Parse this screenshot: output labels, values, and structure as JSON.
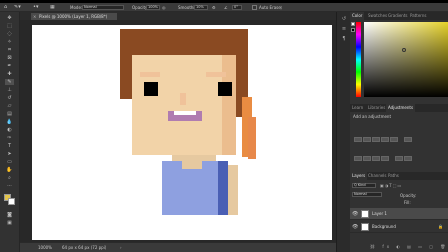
{
  "options_bar": {
    "mode_label": "Mode:",
    "mode_value": "Normal",
    "opacity_label": "Opacity:",
    "opacity_value": "100%",
    "smoothing_label": "Smoothing:",
    "smoothing_value": "10%",
    "angle_value": "0°",
    "auto_erase_label": "Auto Erase"
  },
  "document": {
    "tab_title": "Pixels @ 1000% (Layer 1, RGB/8*)",
    "close_glyph": "×",
    "status_zoom": "1000%",
    "status_info": "64 px x 64 px (72 ppi)"
  },
  "right_panels": {
    "color_tabs": [
      "Color",
      "Swatches",
      "Gradients",
      "Patterns"
    ],
    "adj_tabs": [
      "Learn",
      "Libraries",
      "Adjustments"
    ],
    "adj_heading": "Add an adjustment",
    "layer_tabs": [
      "Layers",
      "Channels",
      "Paths"
    ],
    "kind_label": "Q Kind",
    "blend_value": "Normal",
    "opacity_label": "Opacity:",
    "fill_label": "Fill:",
    "layers": [
      {
        "name": "Layer 1"
      },
      {
        "name": "Background"
      }
    ]
  },
  "colors": {
    "hair": "#8a4a22",
    "skin": "#f2d3a8",
    "skin_shade": "#ebbd8e",
    "ear": "#e98c42",
    "eye": "#000000",
    "cheek": "#f0c29a",
    "mouth": "#b07cb0",
    "teeth": "#ffffff",
    "neck": "#e6c9a0",
    "shirt": "#8ea0e0",
    "shirt_dark": "#4a5fb4",
    "collar": "#e6c9a0",
    "orange_accent": "#e7884a",
    "picker_hue": "#e6d22b"
  }
}
